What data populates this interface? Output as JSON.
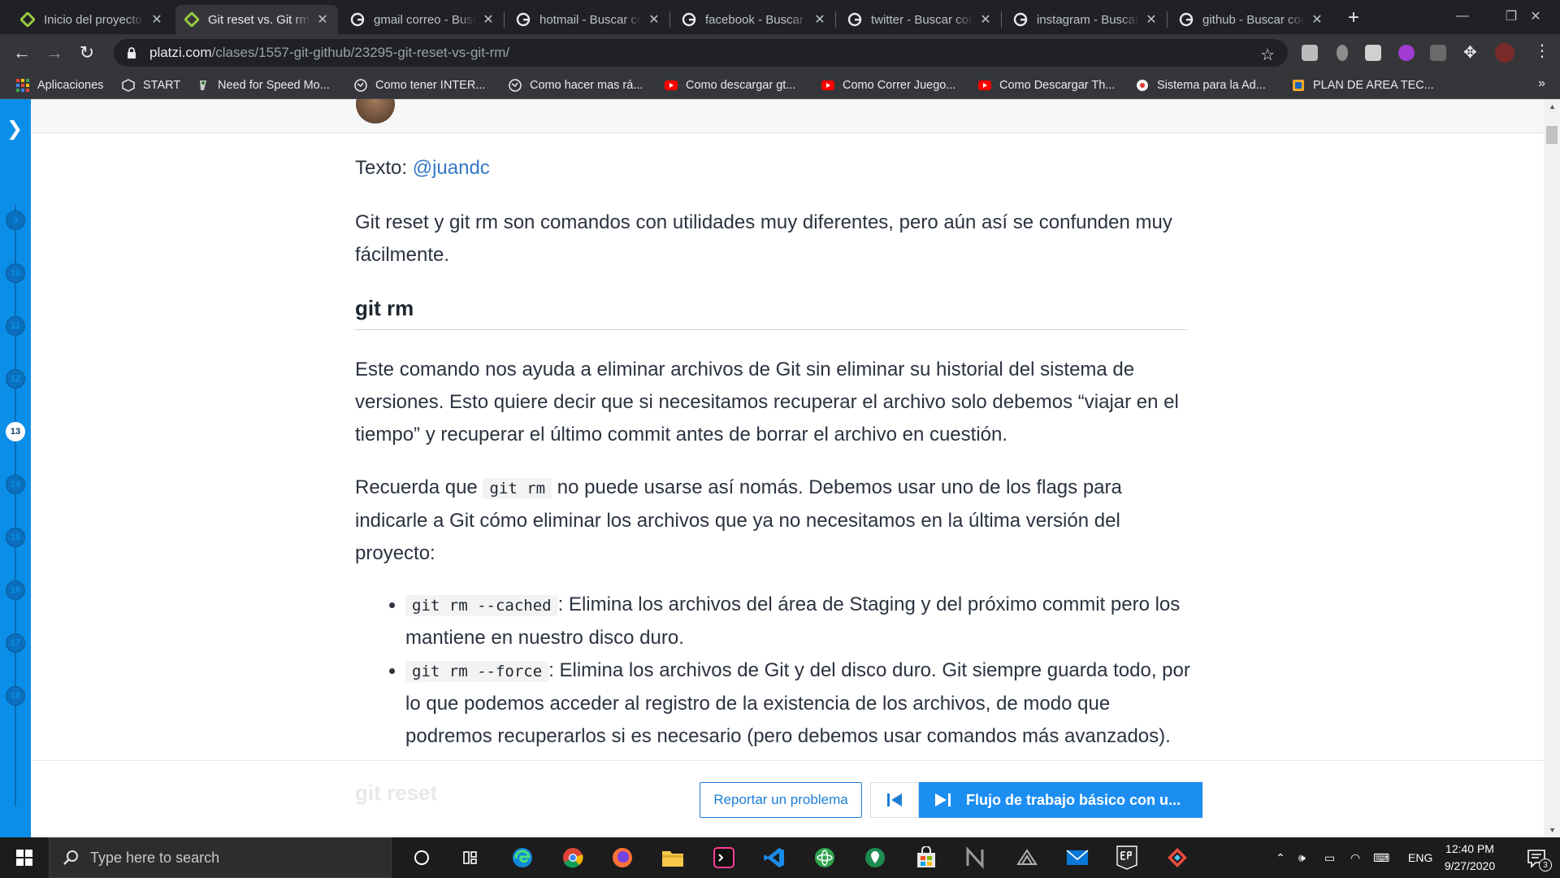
{
  "browser": {
    "tabs": [
      {
        "title": "Inicio del proyecto",
        "icon": "platzi-icon"
      },
      {
        "title": "Git reset vs. Git rm",
        "icon": "platzi-icon"
      },
      {
        "title": "gmail correo - Buscar",
        "icon": "google-icon"
      },
      {
        "title": "hotmail - Buscar con",
        "icon": "google-icon"
      },
      {
        "title": "facebook - Buscar",
        "icon": "google-icon"
      },
      {
        "title": "twitter - Buscar con",
        "icon": "google-icon"
      },
      {
        "title": "instagram - Buscar",
        "icon": "google-icon"
      },
      {
        "title": "github - Buscar con",
        "icon": "google-icon"
      }
    ],
    "active_tab_index": 1,
    "url_host": "platzi.com",
    "url_path": "/clases/1557-git-github/23295-git-reset-vs-git-rm/",
    "bookmarks": [
      {
        "label": "Aplicaciones",
        "icon": "apps-grid-icon"
      },
      {
        "label": "START",
        "icon": "cube-icon"
      },
      {
        "label": "Need for Speed Mo...",
        "icon": "nfs-icon"
      },
      {
        "label": "Como tener INTER...",
        "icon": "globe-icon"
      },
      {
        "label": "Como hacer mas rá...",
        "icon": "globe-icon"
      },
      {
        "label": "Como descargar gt...",
        "icon": "youtube-icon"
      },
      {
        "label": "Como Correr Juego...",
        "icon": "youtube-icon"
      },
      {
        "label": "Como Descargar Th...",
        "icon": "youtube-icon"
      },
      {
        "label": "Sistema para la Ad...",
        "icon": "sistema-icon"
      },
      {
        "label": "PLAN DE AREA TEC...",
        "icon": "plan-icon"
      }
    ]
  },
  "sidebar": {
    "lessons": [
      "9",
      "10",
      "11",
      "12",
      "13",
      "14",
      "15",
      "16",
      "17",
      "18"
    ],
    "current_lesson": "13"
  },
  "article": {
    "texto_label": "Texto: ",
    "texto_author": "@juandc",
    "intro": "Git reset y git rm son comandos con utilidades muy diferentes, pero aún así se confunden muy fácilmente.",
    "section_heading": "git rm",
    "para1": "Este comando nos ayuda a eliminar archivos de Git sin eliminar su historial del sistema de versiones. Esto quiere decir que si necesitamos recuperar el archivo solo debemos “viajar en el tiempo” y recuperar el último commit antes de borrar el archivo en cuestión.",
    "para2_before": "Recuerda que ",
    "para2_code": "git rm",
    "para2_after": " no puede usarse así nomás. Debemos usar uno de los flags para indicarle a Git cómo eliminar los archivos que ya no necesitamos en la última versión del proyecto:",
    "flags": [
      {
        "code": "git rm --cached",
        "text": ": Elimina los archivos del área de Staging y del próximo commit pero los mantiene en nuestro disco duro."
      },
      {
        "code": "git rm --force",
        "text": ": Elimina los archivos de Git y del disco duro. Git siempre guarda todo, por lo que podemos acceder al registro de la existencia de los archivos, de modo que podremos recuperarlos si es necesario (pero debemos usar comandos más avanzados)."
      }
    ],
    "next_heading_faded": "git reset"
  },
  "footer": {
    "report_label": "Reportar un problema",
    "next_label": "Flujo de trabajo básico con u..."
  },
  "taskbar": {
    "search_placeholder": "Type here to search",
    "language": "ENG",
    "time": "12:40 PM",
    "date": "9/27/2020",
    "notification_count": "3"
  },
  "colors": {
    "accent": "#1c8ef2",
    "sidebar": "#0b8ee8",
    "link": "#3478c6"
  }
}
